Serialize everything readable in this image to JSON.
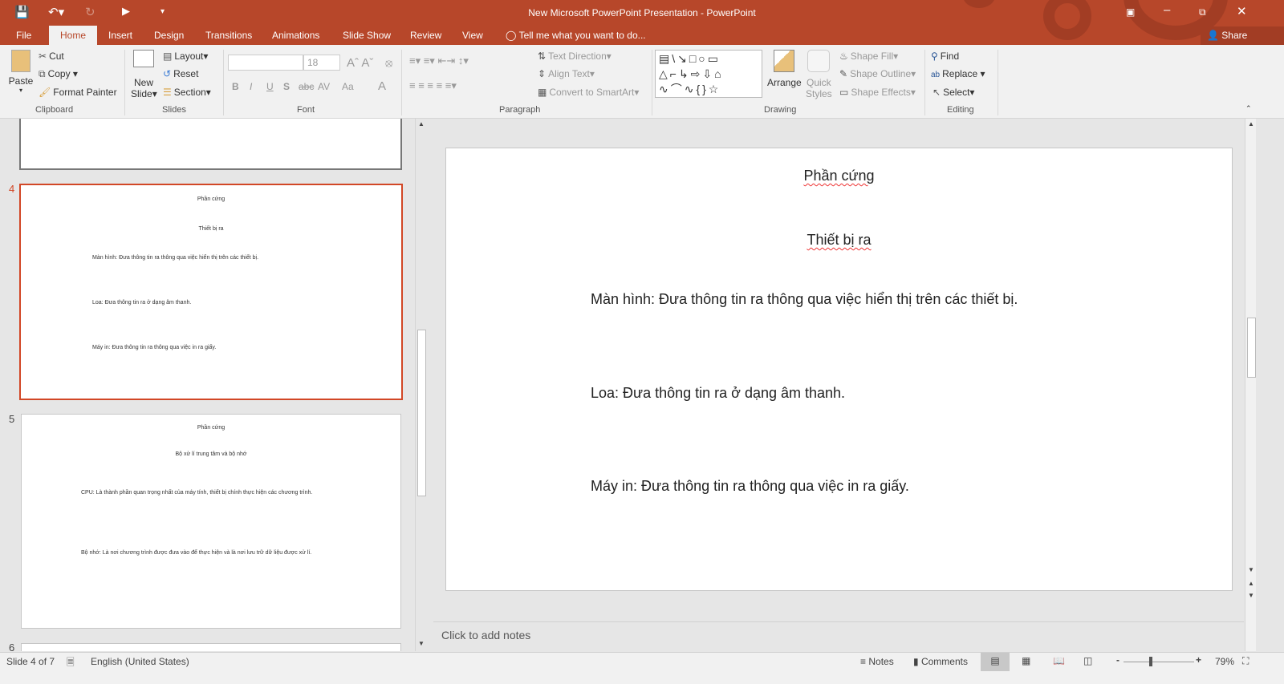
{
  "window": {
    "title": "New Microsoft PowerPoint Presentation - PowerPoint",
    "share": "Share",
    "accent": "#b7472a"
  },
  "tabs": [
    "File",
    "Home",
    "Insert",
    "Design",
    "Transitions",
    "Animations",
    "Slide Show",
    "Review",
    "View"
  ],
  "tell_me": "Tell me what you want to do...",
  "ribbon": {
    "clipboard": {
      "paste": "Paste",
      "cut": "Cut",
      "copy": "Copy",
      "format_painter": "Format Painter",
      "label": "Clipboard"
    },
    "slides": {
      "new_slide": "New",
      "new_slide2": "Slide",
      "layout": "Layout",
      "reset": "Reset",
      "section": "Section",
      "label": "Slides"
    },
    "font": {
      "font_name": "",
      "font_size": "18",
      "label": "Font",
      "buttons": [
        "B",
        "I",
        "U",
        "S",
        "abc",
        "AV",
        "Aa",
        "A"
      ]
    },
    "paragraph": {
      "text_direction": "Text Direction",
      "align_text": "Align Text",
      "smartart": "Convert to SmartArt",
      "label": "Paragraph"
    },
    "drawing": {
      "arrange": "Arrange",
      "quick": "Quick",
      "styles": "Styles",
      "shape_fill": "Shape Fill",
      "shape_outline": "Shape Outline",
      "shape_effects": "Shape Effects",
      "label": "Drawing"
    },
    "editing": {
      "find": "Find",
      "replace": "Replace",
      "select": "Select",
      "label": "Editing"
    }
  },
  "thumbnails": [
    {
      "num": "4",
      "title": "Phần cứng",
      "subtitle": "Thiết bị ra",
      "lines": [
        "Màn hình: Đưa thông tin ra thông qua việc hiển thị trên các thiết bị.",
        "Loa: Đưa thông tin ra ở dạng âm thanh.",
        "Máy in: Đưa thông tin ra thông qua việc in ra giấy."
      ]
    },
    {
      "num": "5",
      "title": "Phần cứng",
      "subtitle": "Bộ xử lí trung tâm và bộ nhớ",
      "lines": [
        "CPU: Là thành phần quan trọng nhất của máy tính, thiết bị chính thực hiện các chương trình.",
        "Bộ nhớ: Là nơi chương trình được đưa vào để thực hiện và là nơi lưu trữ dữ liệu được xử lí."
      ]
    },
    {
      "num": "6"
    }
  ],
  "slide": {
    "title": "Phần cứng",
    "subtitle": "Thiết bị ra",
    "lines": [
      "Màn hình: Đưa thông tin ra thông qua việc hiển thị trên các thiết bị.",
      "Loa: Đưa thông tin ra ở dạng âm thanh.",
      "Máy in: Đưa thông tin ra thông qua việc in ra giấy."
    ]
  },
  "notes_placeholder": "Click to add notes",
  "status": {
    "slide": "Slide 4 of 7",
    "language": "English (United States)",
    "notes": "Notes",
    "comments": "Comments",
    "zoom": "79%",
    "zoom_level": 0.79
  }
}
